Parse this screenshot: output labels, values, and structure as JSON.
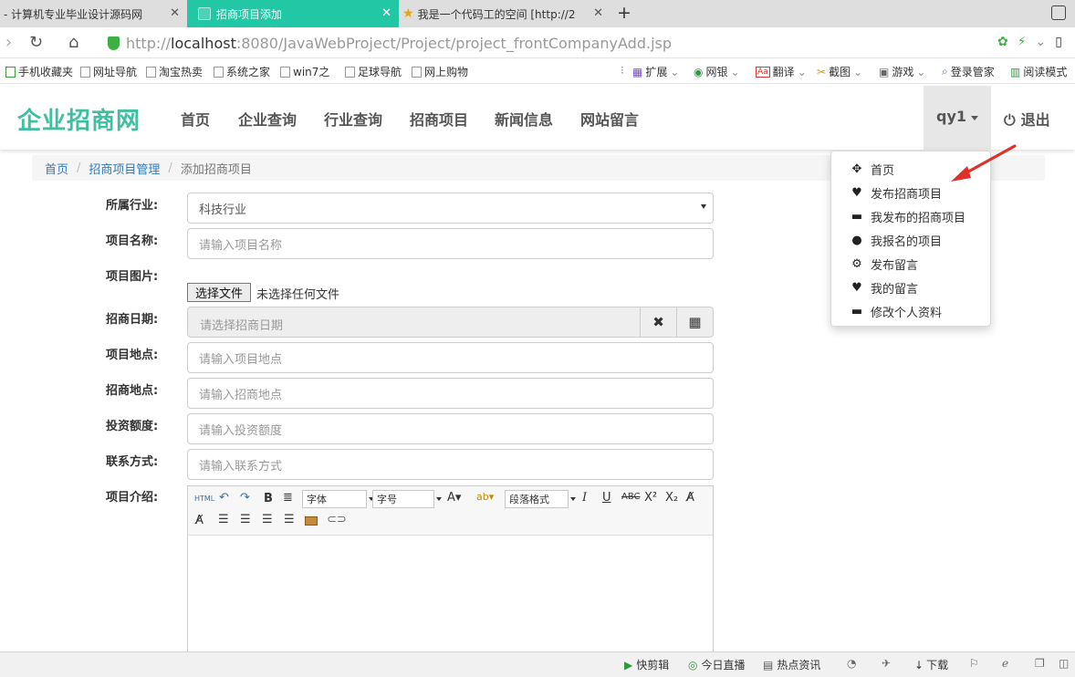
{
  "tabs": [
    {
      "title": "- 计算机专业毕业设计源码网",
      "active": false
    },
    {
      "title": "招商项目添加",
      "active": true
    },
    {
      "title": "我是一个代码工的空间 [http://2",
      "active": false
    }
  ],
  "address": {
    "protocol": "http://",
    "host": "localhost",
    "path": ":8080/JavaWebProject/Project/project_frontCompanyAdd.jsp"
  },
  "bookmarks": [
    "手机收藏夹",
    "网址导航",
    "淘宝热卖",
    "系统之家",
    "win7之",
    "足球导航",
    "网上购物"
  ],
  "bookmark_tools": [
    "扩展",
    "网银",
    "翻译",
    "截图",
    "游戏",
    "登录管家",
    "阅读模式"
  ],
  "site": {
    "logo": "企业招商网",
    "nav": [
      "首页",
      "企业查询",
      "行业查询",
      "招商项目",
      "新闻信息",
      "网站留言"
    ],
    "user": "qy1",
    "logout": "退出"
  },
  "breadcrumb": [
    "首页",
    "招商项目管理",
    "添加招商项目"
  ],
  "form": {
    "industry_label": "所属行业:",
    "industry_value": "科技行业",
    "name_label": "项目名称:",
    "name_placeholder": "请输入项目名称",
    "image_label": "项目图片:",
    "file_button": "选择文件",
    "file_status": "未选择任何文件",
    "date_label": "招商日期:",
    "date_placeholder": "请选择招商日期",
    "location_label": "项目地点:",
    "location_placeholder": "请输入项目地点",
    "invest_location_label": "招商地点:",
    "invest_location_placeholder": "请输入招商地点",
    "amount_label": "投资额度:",
    "amount_placeholder": "请输入投资额度",
    "contact_label": "联系方式:",
    "contact_placeholder": "请输入联系方式",
    "intro_label": "项目介绍:"
  },
  "editor": {
    "html": "HTML",
    "font": "字体",
    "size": "字号",
    "format": "段落格式"
  },
  "dropdown": [
    "首页",
    "发布招商项目",
    "我发布的招商项目",
    "我报名的项目",
    "发布留言",
    "我的留言",
    "修改个人资料"
  ],
  "statusbar": [
    "快剪辑",
    "今日直播",
    "热点资讯",
    "下载"
  ]
}
